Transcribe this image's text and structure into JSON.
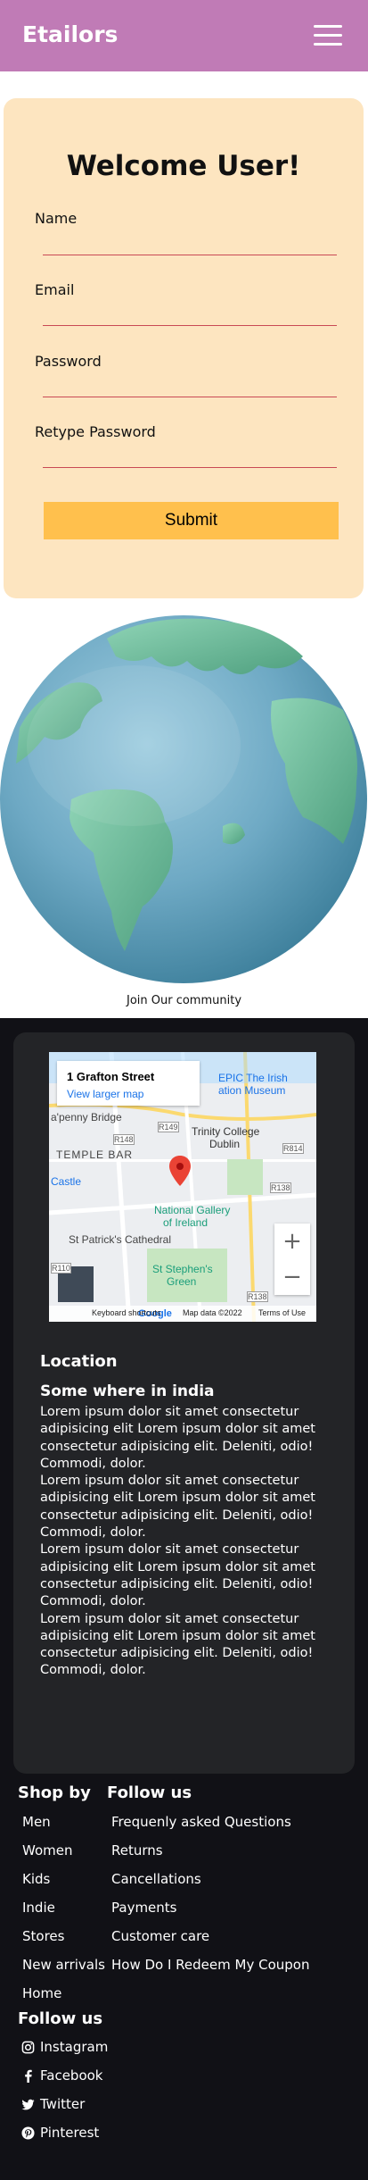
{
  "header": {
    "brand": "Etailors"
  },
  "form": {
    "title": "Welcome User!",
    "fields": [
      {
        "label": "Name",
        "value": ""
      },
      {
        "label": "Email",
        "value": ""
      },
      {
        "label": "Password",
        "value": ""
      },
      {
        "label": "Retype Password",
        "value": ""
      }
    ],
    "submit_label": "Submit"
  },
  "community": {
    "caption": "Join Our community"
  },
  "map": {
    "address": "1 Grafton Street",
    "view_larger": "View larger map",
    "labels": {
      "epic": "EPIC The Irish",
      "museum": "ation Museum",
      "bridge": "a'penny Bridge",
      "temple": "TEMPLE BAR",
      "trinity": "Trinity College",
      "dublin": "Dublin",
      "castle": "Castle",
      "gallery1": "National Gallery",
      "gallery2": "of Ireland",
      "patrick": "St Patrick's Cathedral",
      "stephen1": "St Stephen's",
      "stephen2": "Green",
      "r148": "R148",
      "r149": "R149",
      "r814": "R814",
      "r138a": "R138",
      "r110": "R110",
      "r138b": "R138"
    },
    "footer": {
      "logo": "Google",
      "shortcuts": "Keyboard shortcuts",
      "mapdata": "Map data ©2022",
      "terms": "Terms of Use"
    },
    "zoom_in": "+",
    "zoom_out": "−"
  },
  "location": {
    "title": "Location",
    "subtitle": "Some where in india",
    "paragraphs": [
      "Lorem ipsum dolor sit amet consectetur adipisicing elit Lorem ipsum dolor sit amet consectetur adipisicing elit. Deleniti, odio! Commodi, dolor.",
      "Lorem ipsum dolor sit amet consectetur adipisicing elit Lorem ipsum dolor sit amet consectetur adipisicing elit. Deleniti, odio! Commodi, dolor.",
      "Lorem ipsum dolor sit amet consectetur adipisicing elit Lorem ipsum dolor sit amet consectetur adipisicing elit. Deleniti, odio! Commodi, dolor.",
      "Lorem ipsum dolor sit amet consectetur adipisicing elit Lorem ipsum dolor sit amet consectetur adipisicing elit. Deleniti, odio! Commodi, dolor."
    ]
  },
  "footer": {
    "shop_title": "Shop by",
    "shop_items": [
      "Men",
      "Women",
      "Kids",
      "Indie",
      "Stores",
      "New arrivals",
      "Home"
    ],
    "follow_title": "Follow us",
    "follow_items": [
      "Frequenly asked Questions",
      "Returns",
      "Cancellations",
      "Payments",
      "Customer care",
      "How Do I Redeem My Coupon"
    ],
    "social_title": "Follow us",
    "social_items": [
      {
        "label": "Instagram",
        "icon": "instagram-icon"
      },
      {
        "label": "Facebook",
        "icon": "facebook-icon"
      },
      {
        "label": "Twitter",
        "icon": "twitter-icon"
      },
      {
        "label": "Pinterest",
        "icon": "pinterest-icon"
      }
    ]
  }
}
